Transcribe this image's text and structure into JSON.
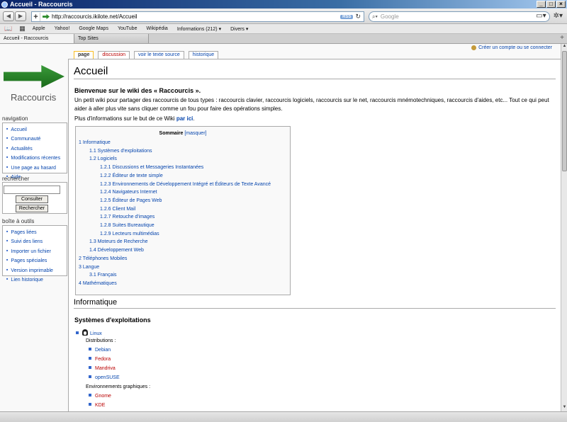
{
  "window": {
    "title": "Accueil - Raccourcis",
    "buttons": [
      "_",
      "□",
      "×"
    ]
  },
  "toolbar": {
    "url": "http://raccourcis.ikilote.net/Accueil",
    "rss": "RSS",
    "search_placeholder": "Google"
  },
  "bookmarks": [
    "Apple",
    "Yahoo!",
    "Google Maps",
    "YouTube",
    "Wikipédia",
    "Informations (212) ▾",
    "Divers ▾"
  ],
  "tabs": [
    "Accueil - Raccourcis",
    "Top Sites"
  ],
  "site": {
    "logo_text": "Raccourcis"
  },
  "personal": {
    "create_account": "Créer un compte ou se connecter"
  },
  "content_tabs": [
    {
      "label": "page",
      "state": "selected"
    },
    {
      "label": "discussion",
      "state": "red"
    },
    {
      "label": "voir le texte source",
      "state": "normal"
    },
    {
      "label": "historique",
      "state": "normal"
    }
  ],
  "sidebar": {
    "navigation_title": "navigation",
    "navigation": [
      "Accueil",
      "Communauté",
      "Actualités",
      "Modifications récentes",
      "Une page au hasard",
      "Aide"
    ],
    "search_title": "rechercher",
    "consult_button": "Consulter",
    "search_button": "Rechercher",
    "toolbox_title": "boîte à outils",
    "toolbox": [
      "Pages liées",
      "Suivi des liens",
      "Importer un fichier",
      "Pages spéciales",
      "Version imprimable",
      "Lien historique"
    ]
  },
  "article": {
    "title": "Accueil",
    "lead_title": "Bienvenue sur le wiki des « Raccourcis ».",
    "lead_text": "Un petit wiki pour partager des raccourcis de tous types : raccourcis clavier, raccourcis logiciels, raccourcis sur le net, raccourcis mnémotechniques, raccourcis d'aides, etc... Tout ce qui peut aider à aller plus vite sans cliquer comme un fou pour faire des opérations simples.",
    "more_prefix": "Plus d'informations sur le but de ce Wiki",
    "more_link": "par ici",
    "more_suffix": "."
  },
  "toc": {
    "title": "Sommaire",
    "hide": "[masquer]",
    "items": [
      {
        "text": "1 Informatique",
        "level": 1
      },
      {
        "text": "1.1 Systèmes d'exploitations",
        "level": 2
      },
      {
        "text": "1.2 Logiciels",
        "level": 2
      },
      {
        "text": "1.2.1 Discussions et Messageries Instantanées",
        "level": 3
      },
      {
        "text": "1.2.2 Éditeur de texte simple",
        "level": 3
      },
      {
        "text": "1.2.3 Environnements de Développement Intégré et Éditeurs de Texte Avancé",
        "level": 3
      },
      {
        "text": "1.2.4 Navigateurs Internet",
        "level": 3
      },
      {
        "text": "1.2.5 Éditeur de Pages Web",
        "level": 3
      },
      {
        "text": "1.2.6 Client Mail",
        "level": 3
      },
      {
        "text": "1.2.7 Retouche d'images",
        "level": 3
      },
      {
        "text": "1.2.8 Suites Bureautique",
        "level": 3
      },
      {
        "text": "1.2.9 Lecteurs multimédias",
        "level": 3
      },
      {
        "text": "1.3 Moteurs de Recherche",
        "level": 2
      },
      {
        "text": "1.4 Développement Web",
        "level": 2
      },
      {
        "text": "2 Téléphones Mobiles",
        "level": 1
      },
      {
        "text": "3 Langue",
        "level": 1
      },
      {
        "text": "3.1 Français",
        "level": 2
      },
      {
        "text": "4 Mathématiques",
        "level": 1
      }
    ]
  },
  "section": {
    "h2": "Informatique",
    "h3": "Systèmes d'exploitations",
    "linux": "Linux",
    "distributions_label": "Distributions :",
    "distributions": [
      {
        "name": "Debian",
        "state": "link"
      },
      {
        "name": "Fedora",
        "state": "red"
      },
      {
        "name": "Mandriva",
        "state": "red"
      },
      {
        "name": "openSUSE",
        "state": "link"
      }
    ],
    "environments_label": "Environnements graphiques :",
    "environments": [
      {
        "name": "Gnome",
        "state": "red"
      },
      {
        "name": "KDE",
        "state": "red"
      }
    ]
  }
}
